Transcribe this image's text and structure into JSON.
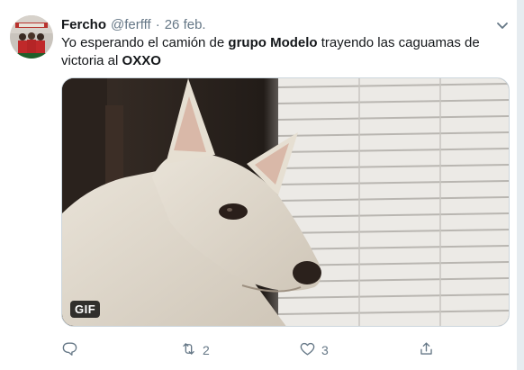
{
  "tweet": {
    "author_name": "Fercho",
    "author_handle": "@ferfff",
    "separator": "·",
    "date": "26 feb.",
    "text_parts": {
      "p1": "Yo esperando el camión de ",
      "b1": "grupo Modelo",
      "p2": " trayendo las caguamas de victoria al ",
      "b2": "OXXO"
    },
    "media": {
      "badge": "GIF"
    },
    "actions": {
      "reply": {
        "icon": "reply-icon",
        "count": ""
      },
      "retweet": {
        "icon": "retweet-icon",
        "count": "2"
      },
      "like": {
        "icon": "heart-icon",
        "count": "3"
      },
      "share": {
        "icon": "share-icon",
        "count": ""
      }
    }
  },
  "colors": {
    "secondary_text": "#657786",
    "primary_text": "#14171a",
    "border": "#ccd6dd"
  }
}
